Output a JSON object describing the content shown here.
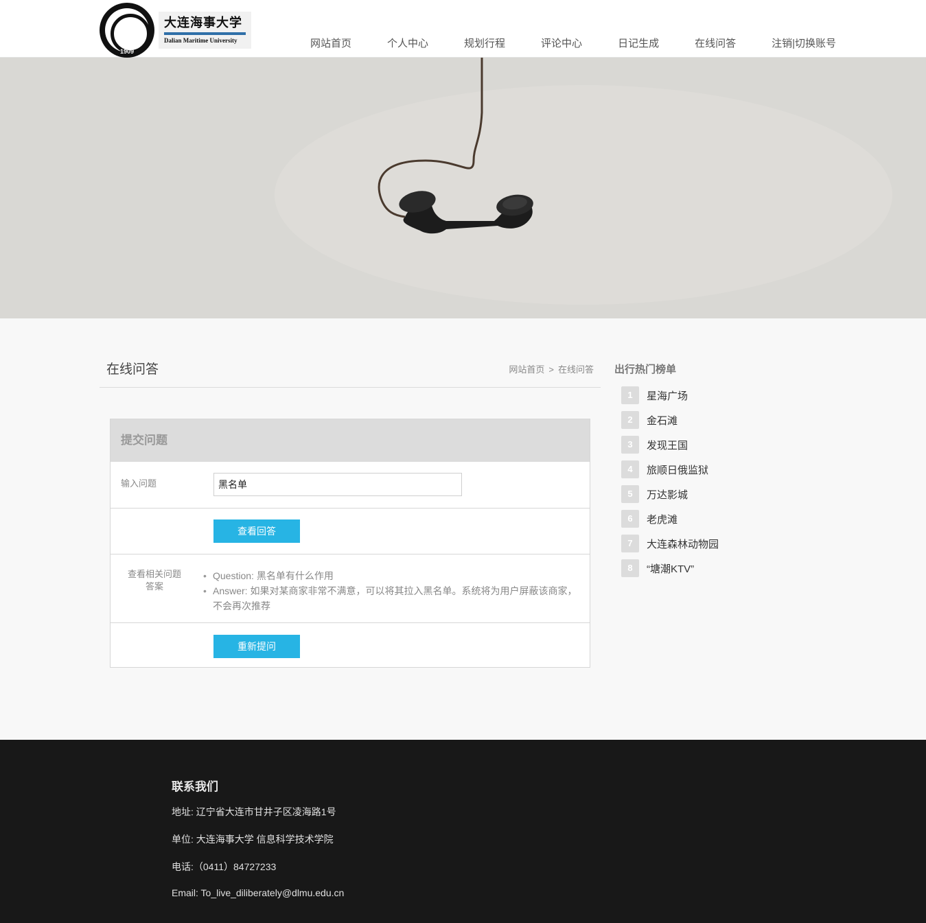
{
  "header": {
    "logo_year": "1909",
    "brand_cn": "大连海事大学",
    "brand_en": "Dalian Maritime University",
    "nav": [
      "网站首页",
      "个人中心",
      "规划行程",
      "评论中心",
      "日记生成",
      "在线问答",
      "注销|切换账号"
    ]
  },
  "main": {
    "title": "在线问答",
    "breadcrumb": {
      "home": "网站首页",
      "separator": ">",
      "current": "在线问答"
    }
  },
  "form": {
    "heading": "提交问题",
    "question_label": "输入问题",
    "question_value": "黑名单",
    "view_button": "查看回答",
    "related_label_1": "查看相关问题",
    "related_label_2": "答案",
    "question_line": "Question: 黑名单有什么作用",
    "answer_line": "Answer: 如果对某商家非常不满意，可以将其拉入黑名单。系统将为用户屏蔽该商家，不会再次推荐",
    "reask_button": "重新提问"
  },
  "sidebar": {
    "title": "出行热门榜单",
    "items": [
      {
        "rank": "1",
        "name": "星海广场"
      },
      {
        "rank": "2",
        "name": "金石滩"
      },
      {
        "rank": "3",
        "name": "发现王国"
      },
      {
        "rank": "4",
        "name": "旅顺日俄监狱"
      },
      {
        "rank": "5",
        "name": "万达影城"
      },
      {
        "rank": "6",
        "name": "老虎滩"
      },
      {
        "rank": "7",
        "name": "大连森林动物园"
      },
      {
        "rank": "8",
        "name": "“塘潮KTV”"
      }
    ]
  },
  "footer": {
    "title": "联系我们",
    "address": "地址: 辽宁省大连市甘井子区凌海路1号",
    "unit": "单位: 大连海事大学 信息科学技术学院",
    "phone": "电话:（0411）84727233",
    "email": "Email: To_live_diliberately@dlmu.edu.cn"
  },
  "colors": {
    "accent": "#27b4e4",
    "footer_bg": "#181818",
    "banner_bg": "#d9d8d4"
  },
  "icons": {
    "banner_image": "hanging-telephone-receiver"
  }
}
